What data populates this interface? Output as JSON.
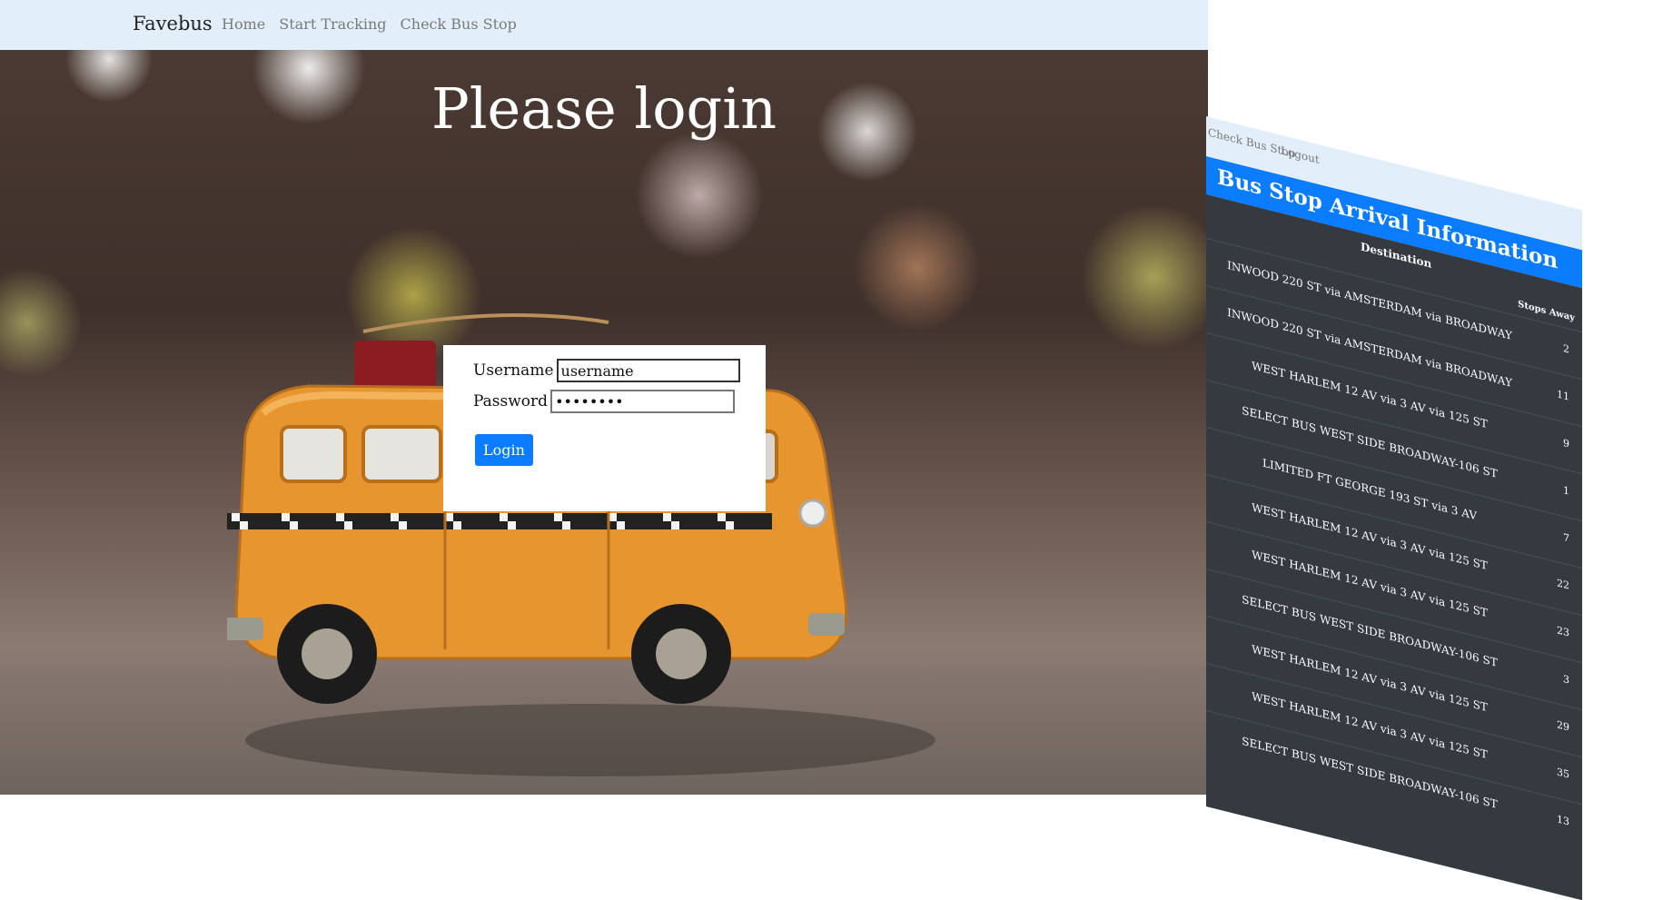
{
  "navbar": {
    "brand": "Favebus",
    "links": [
      "Home",
      "Start Tracking",
      "Check Bus Stop"
    ]
  },
  "hero": {
    "title": "Please login"
  },
  "login": {
    "username_label": "Username",
    "username_value": "username",
    "password_label": "Password",
    "password_value": "••••••••",
    "button_label": "Login"
  },
  "arrivals_preview": {
    "nav_links": [
      "Check Bus Stop",
      "Logout"
    ],
    "title": "Bus Stop Arrival Information",
    "col_destination": "Destination",
    "col_stops": "Stops Away",
    "rows": [
      {
        "destination": "INWOOD 220 ST via AMSTERDAM via BROADWAY",
        "stops": "2"
      },
      {
        "destination": "INWOOD 220 ST via AMSTERDAM via BROADWAY",
        "stops": "11"
      },
      {
        "destination": "WEST HARLEM 12 AV via 3 AV via 125 ST",
        "stops": "9"
      },
      {
        "destination": "SELECT BUS WEST SIDE BROADWAY-106 ST",
        "stops": "1"
      },
      {
        "destination": "LIMITED FT GEORGE 193 ST via 3 AV",
        "stops": "7"
      },
      {
        "destination": "WEST HARLEM 12 AV via 3 AV via 125 ST",
        "stops": "22"
      },
      {
        "destination": "WEST HARLEM 12 AV via 3 AV via 125 ST",
        "stops": "23"
      },
      {
        "destination": "SELECT BUS WEST SIDE BROADWAY-106 ST",
        "stops": "3"
      },
      {
        "destination": "WEST HARLEM 12 AV via 3 AV via 125 ST",
        "stops": "29"
      },
      {
        "destination": "WEST HARLEM 12 AV via 3 AV via 125 ST",
        "stops": "35"
      },
      {
        "destination": "SELECT BUS WEST SIDE BROADWAY-106 ST",
        "stops": "13"
      }
    ]
  },
  "colors": {
    "navbar_bg": "#e2effb",
    "accent": "#0a7cff",
    "table_bg": "#343a40"
  }
}
